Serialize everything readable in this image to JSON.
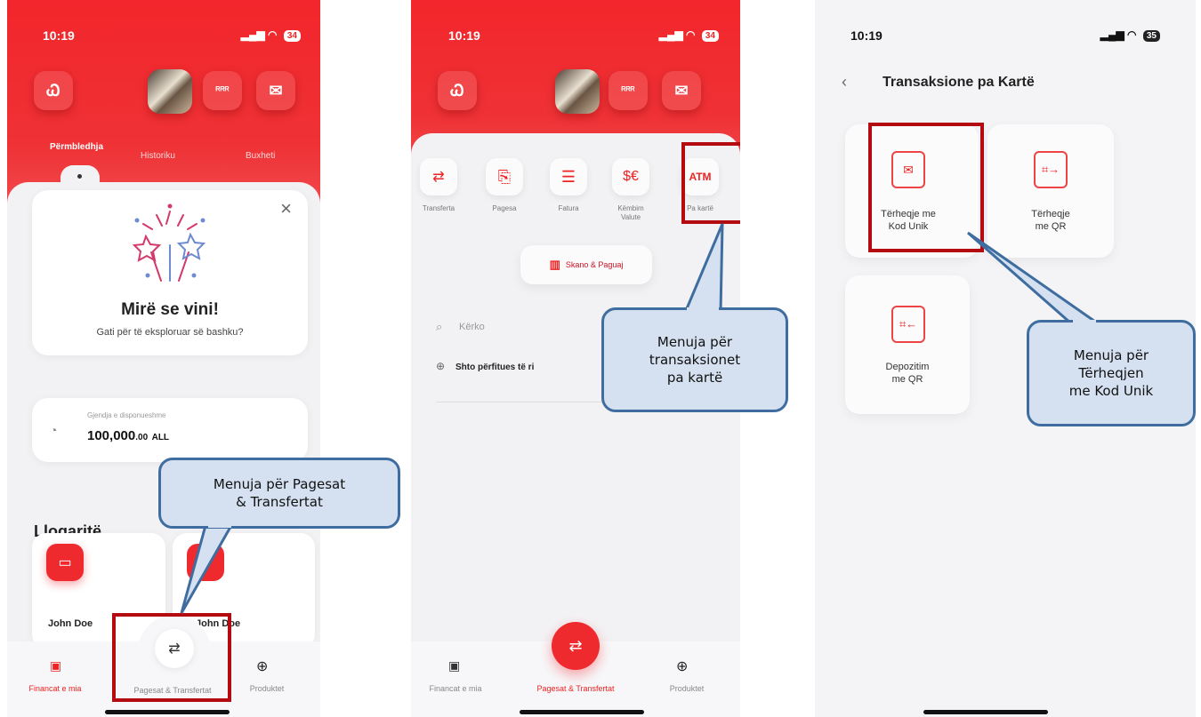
{
  "colors": {
    "brand_red": "#ef2a2f",
    "highlight": "#b30b0f",
    "callout_fill": "#d5e1f1",
    "callout_border": "#3f6d9f"
  },
  "screen1": {
    "time": "10:19",
    "battery": "34",
    "header_icons": [
      "butterfly-logo-icon",
      "profile-avatar",
      "people-icon",
      "mail-icon"
    ],
    "tabs": [
      "Përmbledhja",
      "Historiku",
      "Buxheti"
    ],
    "welcome": {
      "title": "Mirë se vini!",
      "subtitle": "Gati për të eksploruar së bashku?"
    },
    "balance": {
      "label": "Gjendja e disponueshme",
      "amount": "100,000",
      "decimals": ".00",
      "currency": "ALL"
    },
    "accounts": {
      "title": "Llogaritë",
      "names": [
        "John Doe",
        "John Doe"
      ]
    },
    "nav": [
      "Financat e mia",
      "Pagesat & Transfertat",
      "Produktet"
    ],
    "callout": "Menuja për Pagesat\n& Transfertat"
  },
  "screen2": {
    "time": "10:19",
    "battery": "34",
    "actions": [
      "Transferta",
      "Pagesa",
      "Fatura",
      "Këmbim\nValute",
      "Pa kartë"
    ],
    "scan_label": "Skano & Paguaj",
    "search_placeholder": "Kërko",
    "add_beneficiary": "Shto përfitues të ri",
    "nav": [
      "Financat e mia",
      "Pagesat & Transfertat",
      "Produktet"
    ],
    "callout": "Menuja për\ntransaksionet\npa kartë"
  },
  "screen3": {
    "time": "10:19",
    "battery": "35",
    "title": "Transaksione pa Kartë",
    "options": [
      "Tërheqje me\nKod Unik",
      "Tërheqje\nme QR",
      "Depozitim\nme QR"
    ],
    "callout": "Menuja për\nTërheqjen\nme Kod Unik"
  }
}
